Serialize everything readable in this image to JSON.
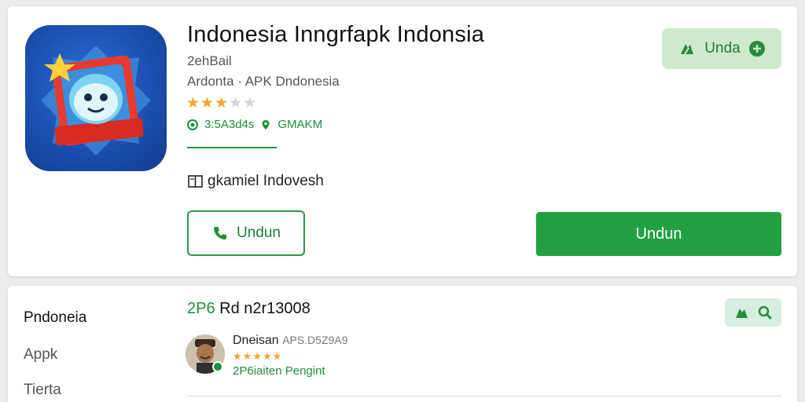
{
  "app": {
    "title": "Indonesia Inngrfapk Indonsia",
    "developer": "2ehBail",
    "category": "Ardonta · APK Dndonesia",
    "rating_stars": 3,
    "rating_max": 5,
    "meta_downloads": "3:5A3d4s",
    "meta_size": "GMAKM",
    "tag_label": "gkamiel Indovesh"
  },
  "buttons": {
    "top_right_label": "Unda",
    "outline_label": "Undun",
    "primary_label": "Undun"
  },
  "sidebar": {
    "items": [
      {
        "label": "Pndoneia"
      },
      {
        "label": "Appk"
      },
      {
        "label": "Tierta"
      }
    ]
  },
  "section": {
    "heading_prefix": "2P6",
    "heading_rest": "Rd n2r13008"
  },
  "review": {
    "name": "Dneisan",
    "sub": "APS.D5Z9A9",
    "stars": 5,
    "note": "2P6iaiten Pengint"
  },
  "colors": {
    "accent_green": "#23a043",
    "star_gold": "#f4a52a",
    "icon_blue": "#1b4fb0",
    "chip_green": "#cfe9cc"
  },
  "icons": {
    "meta_downloads_icon": "download-circle-icon",
    "meta_size_icon": "location-pin-icon",
    "tag_icon": "book-icon",
    "outline_button_icon": "phone-icon",
    "top_right_icons": [
      "recycle-icon",
      "plus-circle-icon"
    ],
    "chip_icons": [
      "recycle-icon",
      "search-icon"
    ]
  }
}
